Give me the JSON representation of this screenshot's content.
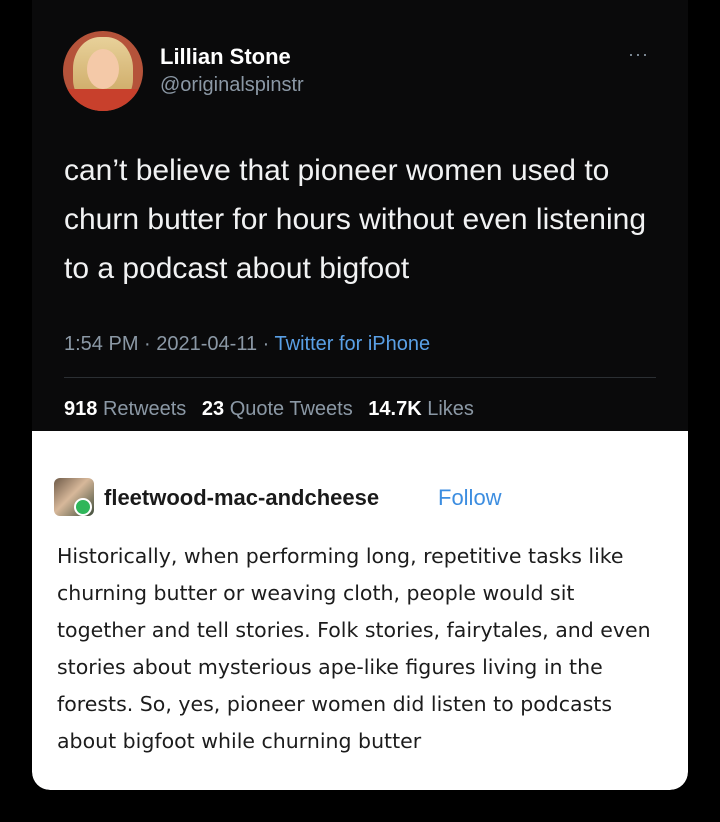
{
  "tweet": {
    "author_name": "Lillian Stone",
    "author_handle": "@originalspinstr",
    "more_label": "···",
    "text": "can’t believe that pioneer women used to churn butter for hours without even listening to a podcast about bigfoot",
    "time": "1:54 PM",
    "date": "2021-04-11",
    "separator": " · ",
    "client": "Twitter for iPhone",
    "retweets_count": "918",
    "retweets_label": "Retweets",
    "quotes_count": "23",
    "quotes_label": "Quote Tweets",
    "likes_count": "14.7K",
    "likes_label": "Likes"
  },
  "reply": {
    "username": "fleetwood-mac-andcheese",
    "follow_label": "Follow",
    "text": "Historically, when performing long, repetitive tasks like churning butter or weaving cloth, people would sit together and tell stories. Folk stories, fairytales, and even stories about mysterious ape-like figures living in the forests. So, yes, pioneer women did listen to podcasts about bigfoot while churning butter"
  },
  "colors": {
    "tweet_bg": "#0a0a0b",
    "link_blue": "#5aa0e6",
    "muted": "#8b98a5",
    "follow_blue": "#3c8de0"
  }
}
